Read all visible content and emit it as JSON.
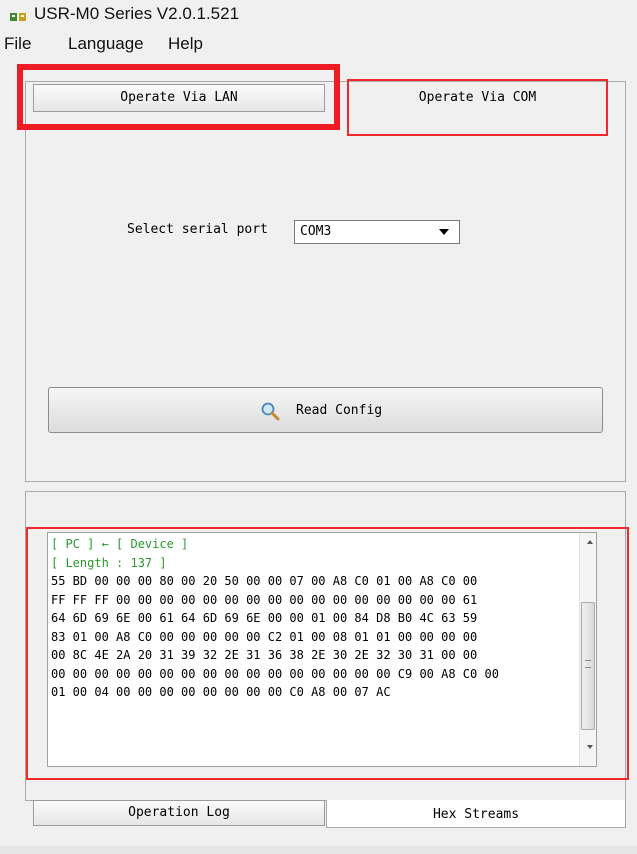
{
  "window": {
    "title": "USR-M0 Series V2.0.1.521"
  },
  "menu": {
    "items": [
      "File",
      "Language",
      "Help"
    ]
  },
  "tabs": {
    "lan_label": "Operate Via LAN",
    "com_label": "Operate Via COM"
  },
  "serial": {
    "label": "Select serial port",
    "selected": "COM3"
  },
  "read_config": {
    "label": "Read Config"
  },
  "log": {
    "lines": [
      "[ PC ] ← [ Device ]",
      "[ Length : 137 ]",
      "55 BD 00 00 00 80 00 20 50 00 00 07 00 A8 C0 01 00 A8 C0 00",
      "FF FF FF 00 00 00 00 00 00 00 00 00 00 00 00 00 00 00 00 61",
      "64 6D 69 6E 00 61 64 6D 69 6E 00 00 01 00 84 D8 B0 4C 63 59",
      "83 01 00 A8 C0 00 00 00 00 00 C2 01 00 08 01 01 00 00 00 00",
      "00 8C 4E 2A 20 31 39 32 2E 31 36 38 2E 30 2E 32 30 31 00 00",
      "00 00 00 00 00 00 00 00 00 00 00 00 00 00 00 00 C9 00 A8 C0 00",
      "01 00 04 00 00 00 00 00 00 00 00 C0 A8 00 07 AC"
    ]
  },
  "bottom_tabs": {
    "log_label": "Operation Log",
    "hex_label": "Hex Streams"
  },
  "colors": {
    "annotation_red": "#ee1c25",
    "log_green": "#2a9a2a"
  }
}
